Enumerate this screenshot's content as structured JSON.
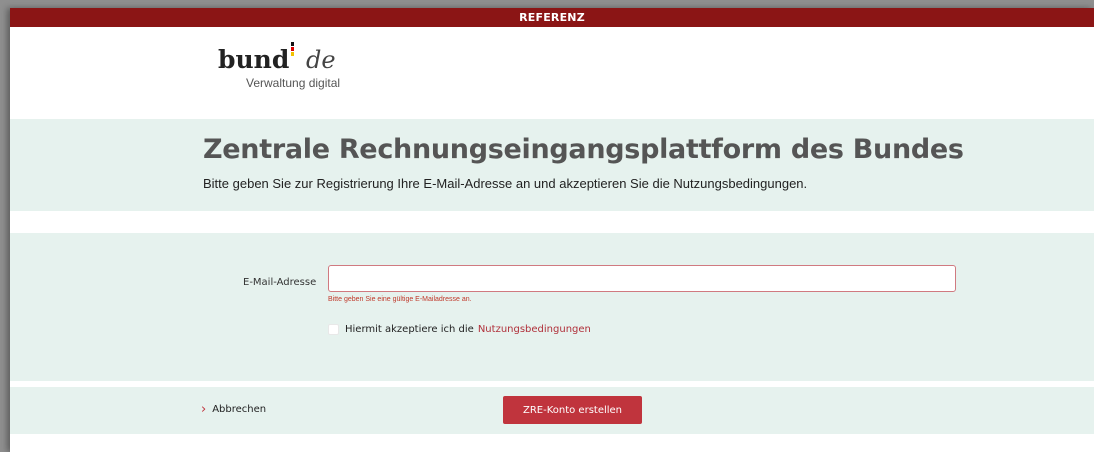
{
  "environment_badge": "REFERENZ",
  "logo": {
    "word": "bund",
    "suffix": "de",
    "tagline": "Verwaltung digital"
  },
  "intro": {
    "title": "Zentrale Rechnungseingangsplattform des Bundes",
    "description": "Bitte geben Sie zur Registrierung Ihre E-Mail-Adresse an und akzeptieren Sie die Nutzungsbedingungen."
  },
  "form": {
    "email_label": "E-Mail-Adresse",
    "email_value": "",
    "email_error": "Bitte geben Sie eine gültige E-Mailadresse an.",
    "terms_text": "Hiermit akzeptiere ich die",
    "terms_link": "Nutzungsbedingungen",
    "terms_checked": false
  },
  "actions": {
    "cancel_label": "Abbrechen",
    "submit_label": "ZRE-Konto erstellen"
  },
  "colors": {
    "top_bar": "#8b1515",
    "section_background": "#e6f2ee",
    "accent_red": "#c0343d"
  }
}
